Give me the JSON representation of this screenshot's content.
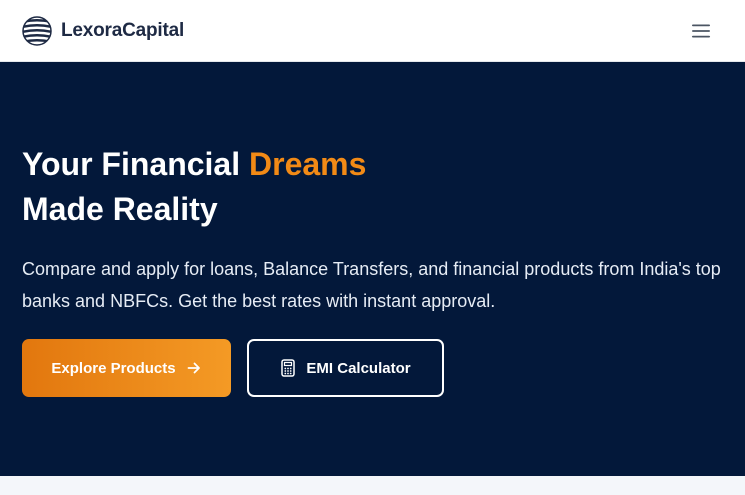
{
  "brand": {
    "name": "LexoraCapital",
    "logo_icon": "globe-stripes-icon"
  },
  "header": {
    "menu_icon": "hamburger-menu-icon"
  },
  "hero": {
    "headline_part1": "Your Financial ",
    "headline_accent": "Dreams",
    "headline_part2": "Made Reality",
    "subtext": "Compare and apply for loans, Balance Transfers, and financial products from India's top banks and NBFCs. Get the best rates with instant approval.",
    "primary_button": {
      "label": "Explore Products",
      "icon": "arrow-right-icon"
    },
    "secondary_button": {
      "label": "EMI Calculator",
      "icon": "calculator-icon"
    }
  },
  "colors": {
    "hero_background": "#03183a",
    "accent": "#f28a16",
    "primary_gradient_start": "#e2770e",
    "primary_gradient_end": "#f49a25",
    "header_background": "#ffffff",
    "brand_text": "#1e2a44"
  }
}
